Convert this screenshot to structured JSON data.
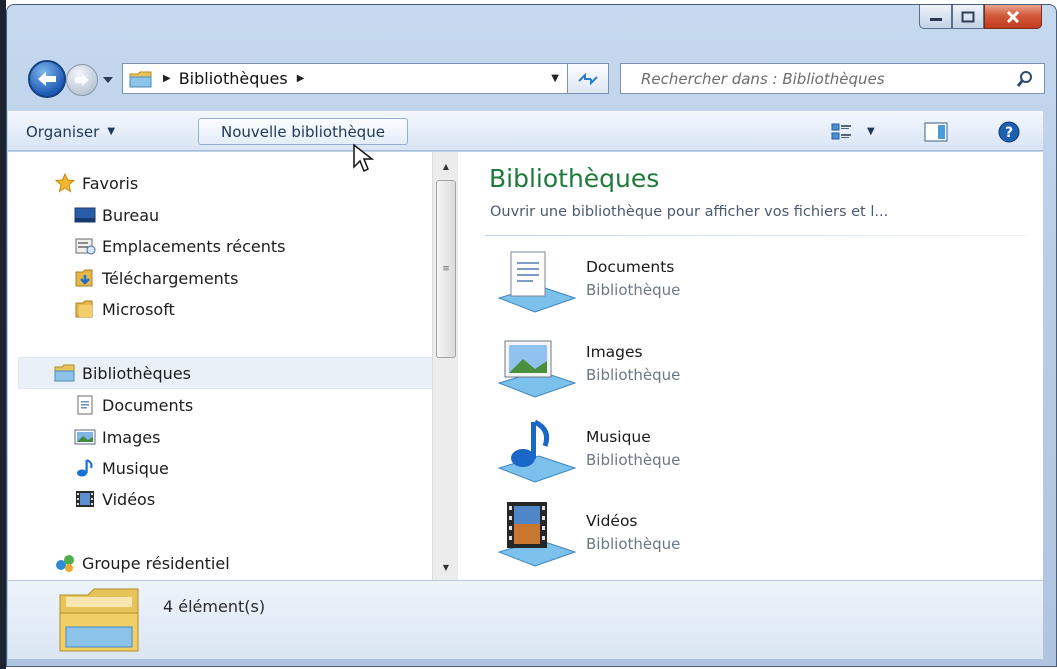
{
  "window": {
    "caption_buttons": [
      "minimize-icon",
      "maximize-icon",
      "close-icon"
    ]
  },
  "address_bar": {
    "crumb": "Bibliothèques",
    "search_placeholder": "Rechercher dans : Bibliothèques"
  },
  "toolbar": {
    "organiser_label": "Organiser",
    "new_library_label": "Nouvelle bibliothèque"
  },
  "nav": {
    "favorites": {
      "label": "Favoris",
      "items": [
        {
          "label": "Bureau",
          "icon": "desktop-icon"
        },
        {
          "label": "Emplacements récents",
          "icon": "recent-places-icon"
        },
        {
          "label": "Téléchargements",
          "icon": "downloads-folder-icon"
        },
        {
          "label": "Microsoft",
          "icon": "folder-icon"
        }
      ]
    },
    "libraries": {
      "label": "Bibliothèques",
      "items": [
        {
          "label": "Documents",
          "icon": "documents-icon"
        },
        {
          "label": "Images",
          "icon": "images-icon"
        },
        {
          "label": "Musique",
          "icon": "music-icon"
        },
        {
          "label": "Vidéos",
          "icon": "videos-icon"
        }
      ]
    },
    "homegroup": {
      "label": "Groupe résidentiel"
    }
  },
  "content": {
    "title": "Bibliothèques",
    "subtitle": "Ouvrir une bibliothèque pour afficher vos fichiers et l...",
    "libraries": [
      {
        "name": "Documents",
        "type": "Bibliothèque",
        "icon": "documents-library-icon"
      },
      {
        "name": "Images",
        "type": "Bibliothèque",
        "icon": "images-library-icon"
      },
      {
        "name": "Musique",
        "type": "Bibliothèque",
        "icon": "music-library-icon"
      },
      {
        "name": "Vidéos",
        "type": "Bibliothèque",
        "icon": "videos-library-icon"
      }
    ]
  },
  "status": {
    "count_text": "4 élément(s)"
  },
  "colors": {
    "title_green": "#1e7a3c",
    "toolbar_text": "#1e3855",
    "selected_row": "#e9f0f8"
  }
}
